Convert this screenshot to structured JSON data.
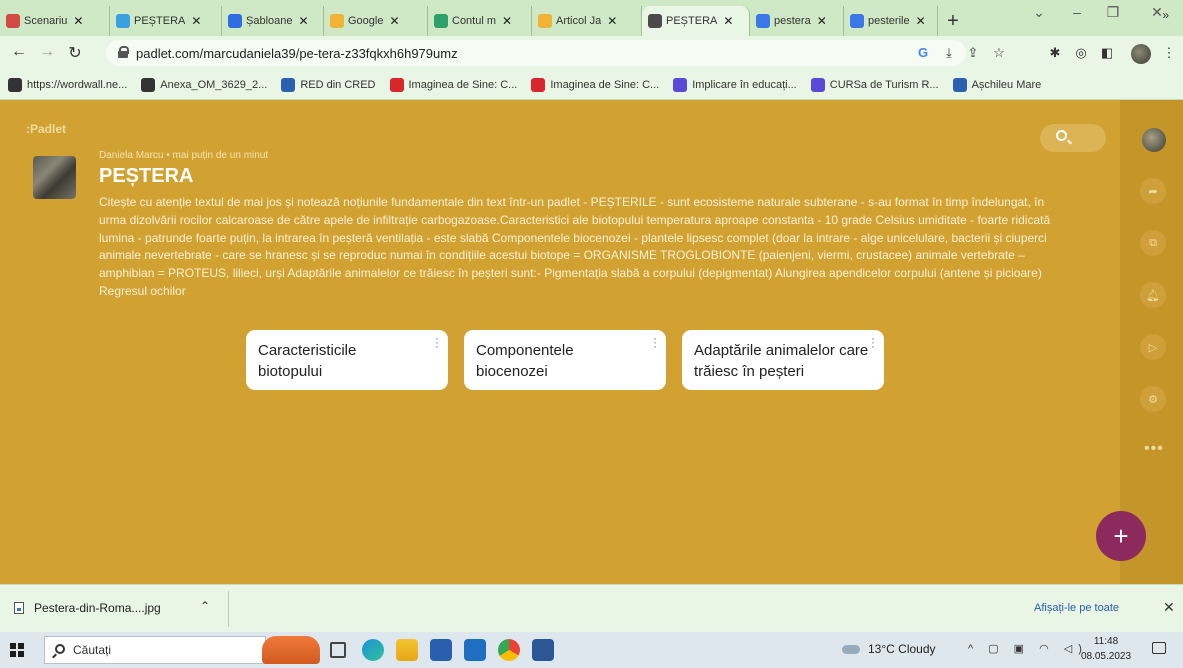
{
  "browser": {
    "tabs": [
      {
        "label": "Scenariu",
        "favicon_color": "#d24a43"
      },
      {
        "label": "PEȘTERA",
        "favicon_color": "#3aa0e0"
      },
      {
        "label": "Șabloane",
        "favicon_color": "#2f6ee0"
      },
      {
        "label": "Google",
        "favicon_color": "#f2b233"
      },
      {
        "label": "Contul m",
        "favicon_color": "#2ea16a"
      },
      {
        "label": "Articol Ja",
        "favicon_color": "#f2b233"
      },
      {
        "label": "PEȘTERA",
        "favicon_color": "#4a4a4a"
      },
      {
        "label": "pestera",
        "favicon_color": "#3b78e7"
      },
      {
        "label": "pesterile",
        "favicon_color": "#3b78e7"
      }
    ],
    "active_tab_index": 6,
    "new_tab_label": "+",
    "url": "padlet.com/marcudaniela39/pe-tera-z33fqkxh6h979umz",
    "bookmarks": [
      {
        "label": "https://wordwall.ne...",
        "icon_color": "#333333"
      },
      {
        "label": "Anexa_OM_3629_2...",
        "icon_color": "#333333"
      },
      {
        "label": "RED din CRED",
        "icon_color": "#2d5fb0"
      },
      {
        "label": "Imaginea de Sine: C...",
        "icon_color": "#d8262b"
      },
      {
        "label": "Imaginea de Sine: C...",
        "icon_color": "#d8262b"
      },
      {
        "label": "Implicare în educați...",
        "icon_color": "#5a4ad8"
      },
      {
        "label": "CURSa de Turism R...",
        "icon_color": "#5a4ad8"
      },
      {
        "label": "Așchileu Mare",
        "icon_color": "#2d5fb0"
      }
    ],
    "bookmarks_more": "»"
  },
  "padlet": {
    "wordmark": ":Padlet",
    "author": "Daniela Marcu",
    "time_ago": "mai puțin de un minut",
    "title": "PEȘTERA",
    "description": "Citește cu atenție textul de mai jos și notează noțiunile fundamentale din text într-un padlet - PEȘTERILE - sunt ecosisteme naturale subterane - s-au format în timp îndelungat, în urma dizolvării rocilor calcaroase de către apele de infiltrație carbogazoase.Caracteristici ale biotopului temperatura aproape constanta - 10 grade Celsius umiditate - foarte ridicată lumina - patrunde foarte puțin, la intrarea în peșteră ventilația - este slabă Componentele biocenozei - plantele lipsesc complet (doar la intrare - alge unicelulare, bacterii și ciuperci animale nevertebrate - care se hranesc și se reproduc numai în condițiile acestui biotope = ORGANISME TROGLOBIONTE (paienjeni, viermi, crustacee) animale vertebrate – amphibian = PROTEUS, lilieci, urși Adaptările animalelor ce trăiesc în peșteri sunt:- Pigmentația slabă a corpului (depigmentat) Alungirea apendicelor corpului (antene și picioare) Regresul ochilor",
    "cards": [
      {
        "title": "Caracteristicile biotopului"
      },
      {
        "title": "Componentele biocenozei"
      },
      {
        "title": "Adaptările animalelor care trăiesc în peșteri"
      }
    ],
    "fab_label": "+",
    "rail_more": "•••",
    "background_color": "#d1a232",
    "fab_color": "#8c2a5e"
  },
  "downloads": {
    "file_name": "Pestera-din-Roma....jpg",
    "show_all": "Afișați-le pe toate",
    "close": "✕"
  },
  "taskbar": {
    "search_placeholder": "Căutați",
    "weather": "13°C  Cloudy",
    "time": "11:48",
    "date": "08.05.2023"
  }
}
